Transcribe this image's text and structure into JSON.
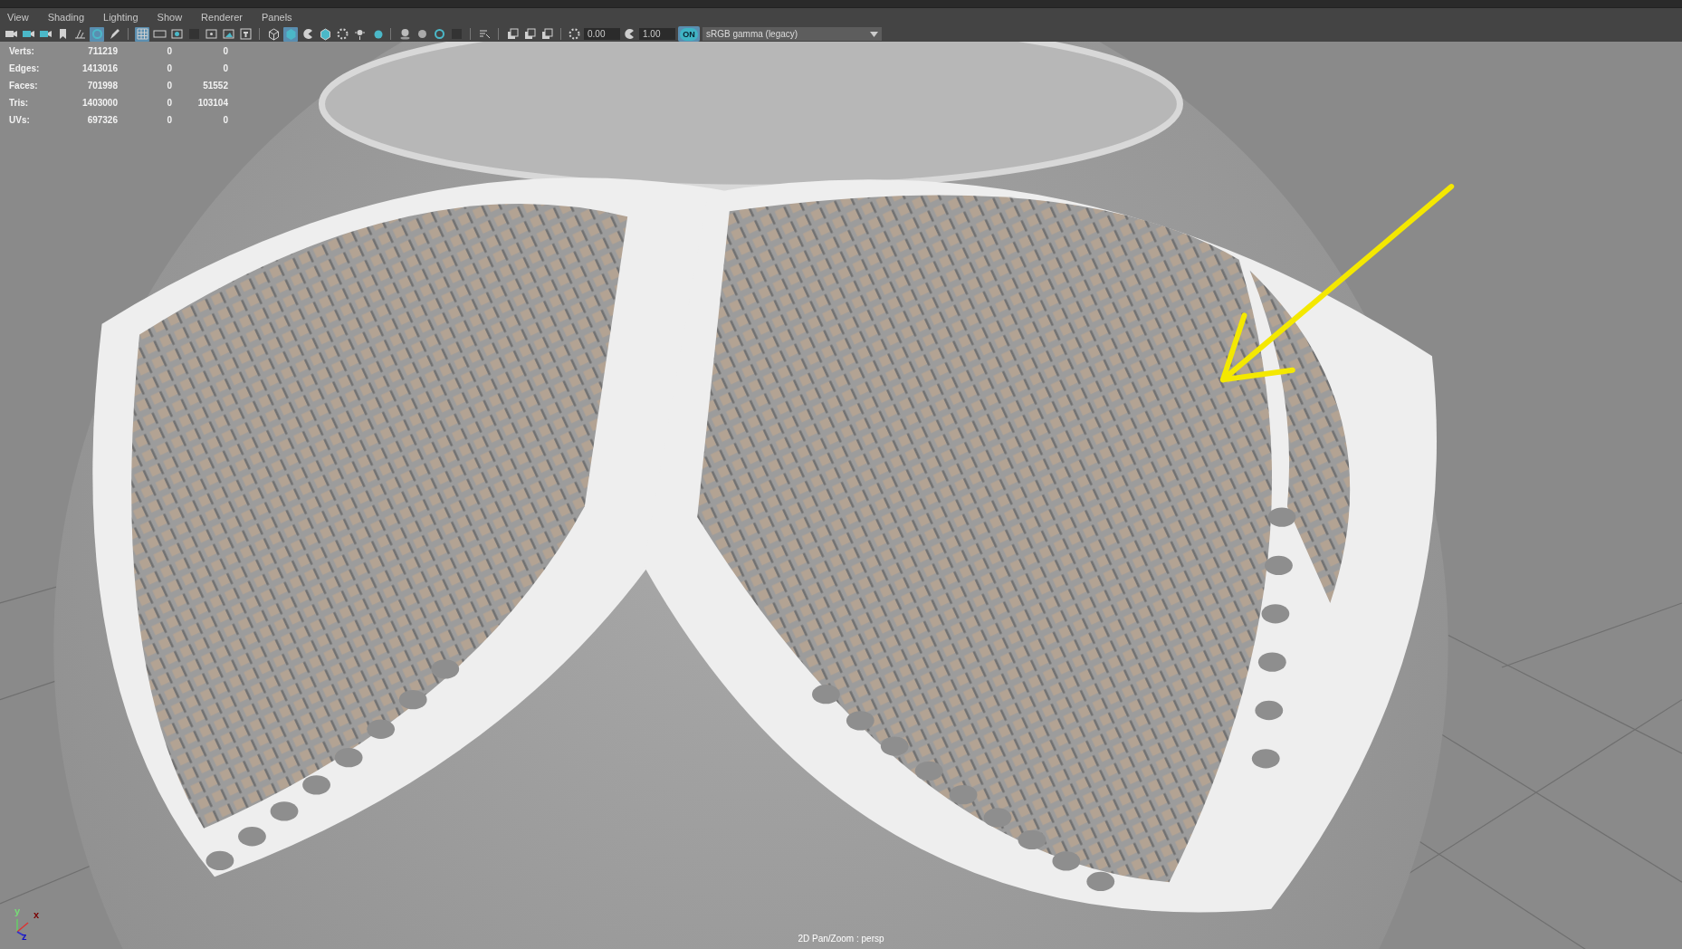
{
  "menu": [
    {
      "label": "View"
    },
    {
      "label": "Shading"
    },
    {
      "label": "Lighting"
    },
    {
      "label": "Show"
    },
    {
      "label": "Renderer"
    },
    {
      "label": "Panels"
    }
  ],
  "toolbar": {
    "button_groups": [
      [
        {
          "selected": false
        },
        {
          "selected": false
        },
        {
          "selected": false
        },
        {
          "selected": false
        },
        {
          "selected": false
        },
        {
          "selected": true
        },
        {
          "selected": false
        }
      ],
      [
        {
          "selected": true
        },
        {
          "selected": false
        },
        {
          "selected": false
        },
        {
          "selected": false
        },
        {
          "selected": false
        },
        {
          "selected": false
        },
        {
          "selected": false
        }
      ],
      [
        {
          "selected": false
        },
        {
          "selected": true
        },
        {
          "selected": false
        },
        {
          "selected": false
        },
        {
          "selected": false
        },
        {
          "selected": false
        },
        {
          "selected": false
        }
      ],
      [
        {
          "selected": false
        },
        {
          "selected": false
        },
        {
          "selected": false
        },
        {
          "selected": false
        }
      ],
      [
        {
          "selected": false
        }
      ],
      [
        {
          "selected": false
        },
        {
          "selected": false
        },
        {
          "selected": false
        }
      ]
    ],
    "exposure": "0.00",
    "gamma": "1.00",
    "color_management": {
      "label": "ON",
      "on": true
    },
    "color_space": "sRGB gamma (legacy)"
  },
  "stats": [
    {
      "label": "Verts:",
      "values": [
        "711219",
        "0",
        "0"
      ]
    },
    {
      "label": "Edges:",
      "values": [
        "1413016",
        "0",
        "0"
      ]
    },
    {
      "label": "Faces:",
      "values": [
        "701998",
        "0",
        "51552"
      ]
    },
    {
      "label": "Tris:",
      "values": [
        "1403000",
        "0",
        "103104"
      ]
    },
    {
      "label": "UVs:",
      "values": [
        "697326",
        "0",
        "0"
      ]
    }
  ],
  "axis": {
    "y": "y",
    "x": "x",
    "z": "z"
  },
  "camera_label": "2D Pan/Zoom : persp"
}
